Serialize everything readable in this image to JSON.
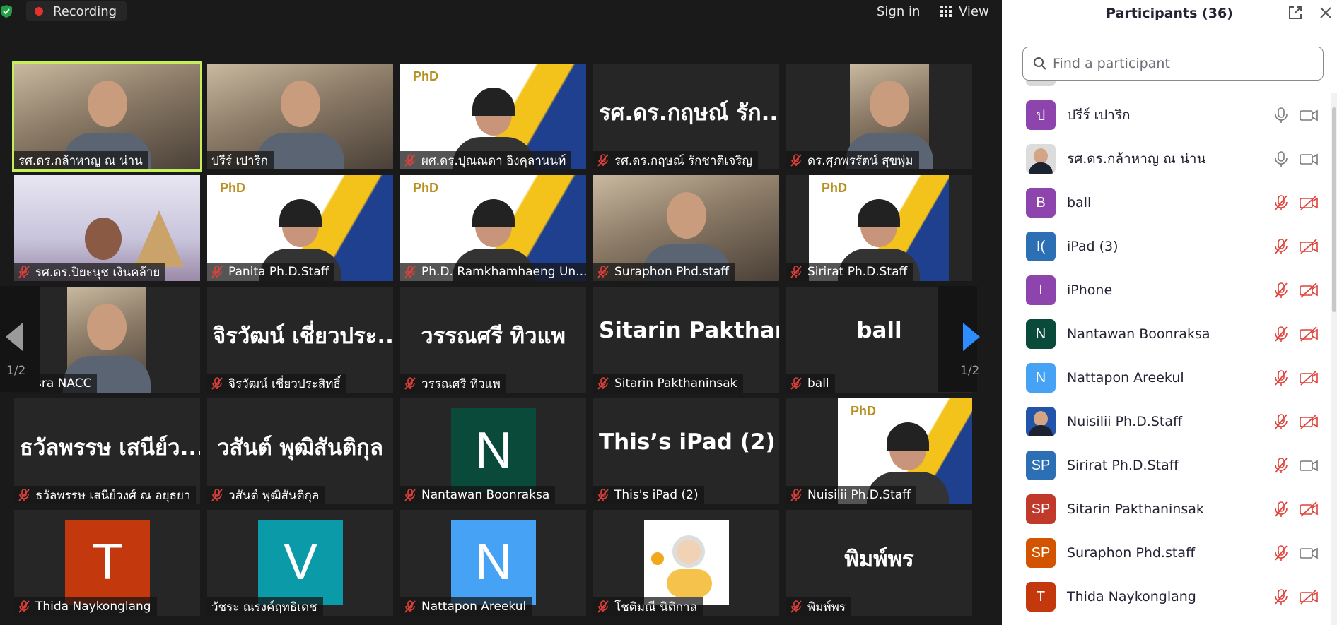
{
  "topbar": {
    "recording_label": "Recording",
    "sign_in_label": "Sign in",
    "view_label": "View"
  },
  "colors": {
    "active_speaker": "#c5ee5b",
    "recording_red": "#e5322d",
    "muted_red": "#e0413a",
    "nav_blue": "#2d8cff"
  },
  "gallery": {
    "page_left": "1/2",
    "page_right": "1/2",
    "tiles": [
      {
        "name": "รศ.ดร.กล้าหาญ  ณ น่าน",
        "muted": false,
        "active": true,
        "video": "person-video"
      },
      {
        "name": "ปรีร์ เปาริก",
        "muted": false,
        "video": "person-video"
      },
      {
        "name": "ผศ.ดร.ปุณณดา อิงคุลานนท์",
        "muted": true,
        "video": "background-phd"
      },
      {
        "name": "รศ.ดร.กฤษณ์ รักชาติเจริญ",
        "muted": true,
        "display": "รศ.ดร.กฤษณ์ รัก..."
      },
      {
        "name": "ดร.ศุภพรรัตน์ สุขพุ่ม",
        "muted": true,
        "video": "person-video"
      },
      {
        "name": "รศ.ดร.ปิยะนุช เงินคล้าย",
        "muted": true,
        "video": "background-city"
      },
      {
        "name": "Panita Ph.D.Staff",
        "muted": true,
        "video": "background-phd"
      },
      {
        "name": "Ph.D. Ramkhamhaeng Un...",
        "muted": true,
        "video": "background-phd"
      },
      {
        "name": "Suraphon Phd.staff",
        "muted": true,
        "video": "person-video"
      },
      {
        "name": "Sirirat Ph.D.Staff",
        "muted": true,
        "video": "background-phd"
      },
      {
        "name": "sra NACC",
        "muted": true,
        "video": "person-video"
      },
      {
        "name": "จิรวัฒน์ เชี่ยวประสิทธิ์",
        "muted": true,
        "display": "จิรวัฒน์ เชี่ยวประ..."
      },
      {
        "name": "วรรณศรี  ทิวแพ",
        "muted": true,
        "display": "วรรณศรี  ทิวแพ"
      },
      {
        "name": "Sitarin Pakthaninsak",
        "muted": true,
        "display": "Sitarin  Pakthani..."
      },
      {
        "name": "ball",
        "muted": true,
        "display": "ball"
      },
      {
        "name": "ธวัลพรรษ เสนีย์วงศ์ ณ อยุธยา",
        "muted": true,
        "display": "ธวัลพรรษ เสนีย์ว..."
      },
      {
        "name": "วสันต์ พุฒิสันติกุล",
        "muted": true,
        "display": "วสันต์ พุฒิสันติกุล"
      },
      {
        "name": "Nantawan Boonraksa",
        "muted": true,
        "avatar": "N",
        "avatar_color": "#0a4a3a"
      },
      {
        "name": "This's iPad (2)",
        "muted": true,
        "display": "This’s iPad (2)"
      },
      {
        "name": "Nuisilii Ph.D.Staff",
        "muted": true,
        "video": "background-phd"
      },
      {
        "name": "Thida Naykonglang",
        "muted": true,
        "avatar": "T",
        "avatar_color": "#c4380e"
      },
      {
        "name": "วัชระ ณรงค์ฤทธิเดช",
        "muted": false,
        "avatar": "V",
        "avatar_color": "#0b9aa8"
      },
      {
        "name": "Nattapon Areekul",
        "muted": true,
        "avatar": "N",
        "avatar_color": "#45a2f5"
      },
      {
        "name": "โชติมณี นิติกาล",
        "muted": true,
        "video": "avatar-illustration"
      },
      {
        "name": "พิมพ์พร",
        "muted": true,
        "display": "พิมพ์พร"
      }
    ]
  },
  "participants": {
    "title": "Participants (36)",
    "search_placeholder": "Find a participant",
    "items": [
      {
        "initials": "ป",
        "name": "ปรีร์ เปาริก",
        "color": "#8e44ad",
        "mic": "on",
        "cam": "on"
      },
      {
        "initials": "",
        "name": "รศ.ดร.กล้าหาญ  ณ น่าน",
        "color": "#dcdcdc",
        "mic": "on",
        "cam": "on",
        "photo": true
      },
      {
        "initials": "B",
        "name": "ball",
        "color": "#8e44ad",
        "mic": "off",
        "cam": "off"
      },
      {
        "initials": "I(",
        "name": "iPad (3)",
        "color": "#2d6fb5",
        "mic": "off",
        "cam": "off"
      },
      {
        "initials": "I",
        "name": "iPhone",
        "color": "#8e44ad",
        "mic": "off",
        "cam": "off"
      },
      {
        "initials": "N",
        "name": "Nantawan Boonraksa",
        "color": "#0a4a3a",
        "mic": "off",
        "cam": "off"
      },
      {
        "initials": "N",
        "name": "Nattapon Areekul",
        "color": "#45a2f5",
        "mic": "off",
        "cam": "off"
      },
      {
        "initials": "",
        "name": "Nuisilii Ph.D.Staff",
        "color": "#2255aa",
        "mic": "off",
        "cam": "off",
        "photo": true
      },
      {
        "initials": "SP",
        "name": "Sirirat Ph.D.Staff",
        "color": "#2d6fb5",
        "mic": "off",
        "cam": "on"
      },
      {
        "initials": "SP",
        "name": "Sitarin Pakthaninsak",
        "color": "#c0392b",
        "mic": "off",
        "cam": "off"
      },
      {
        "initials": "SP",
        "name": "Suraphon Phd.staff",
        "color": "#d35400",
        "mic": "off",
        "cam": "on"
      },
      {
        "initials": "T",
        "name": "Thida Naykonglang",
        "color": "#c4380e",
        "mic": "off",
        "cam": "off"
      }
    ]
  }
}
